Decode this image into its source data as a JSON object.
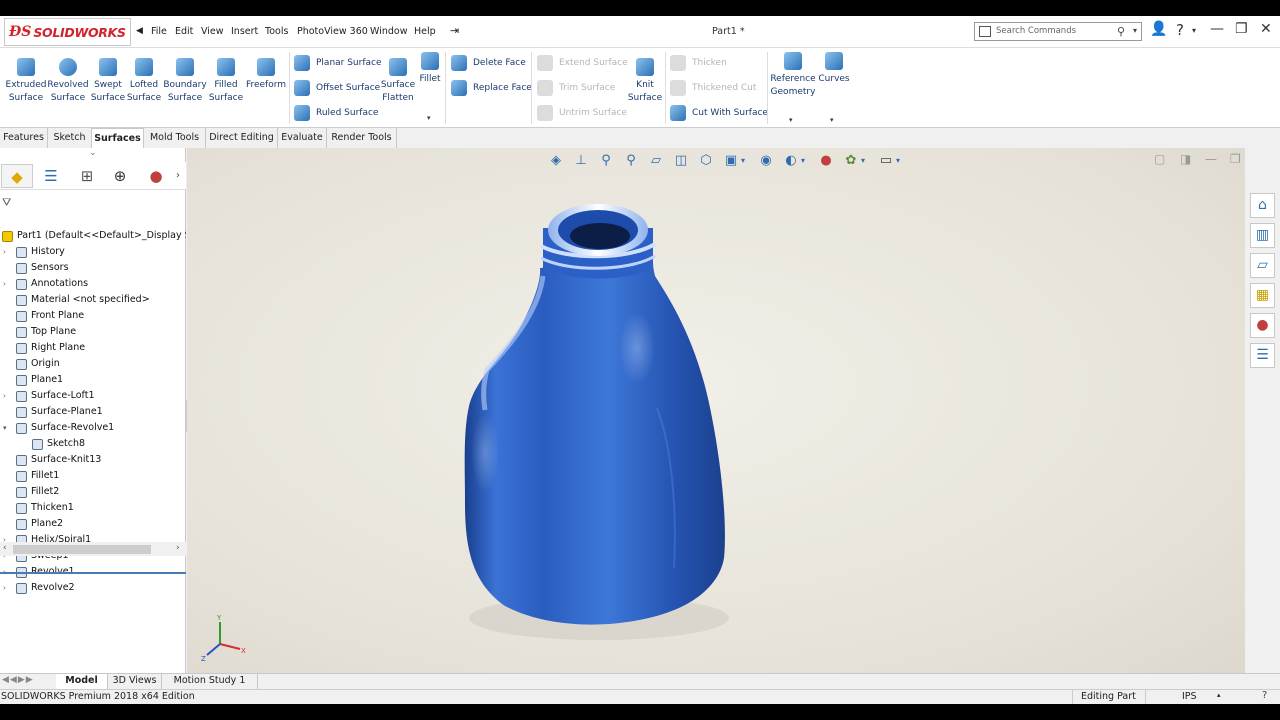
{
  "app": {
    "brand": "SOLIDWORKS",
    "doc_title": "Part1 *",
    "menu": [
      "File",
      "Edit",
      "View",
      "Insert",
      "Tools",
      "PhotoView 360",
      "Window",
      "Help"
    ],
    "search_placeholder": "Search Commands"
  },
  "ribbon": {
    "large": [
      {
        "label": "Extruded Surface"
      },
      {
        "label": "Revolved Surface"
      },
      {
        "label": "Swept Surface"
      },
      {
        "label": "Lofted Surface"
      },
      {
        "label": "Boundary Surface"
      },
      {
        "label": "Filled Surface"
      },
      {
        "label": "Freeform"
      }
    ],
    "group2": [
      "Planar Surface",
      "Offset Surface",
      "Ruled Surface"
    ],
    "surface_flatten": "Surface Flatten",
    "fillet": "Fillet",
    "group3": [
      "Delete Face",
      "Replace Face"
    ],
    "group4_disabled": [
      "Extend Surface",
      "Trim Surface",
      "Untrim Surface"
    ],
    "knit_surface": "Knit Surface",
    "group5": [
      "Thicken",
      "Thickened Cut",
      "Cut With Surface"
    ],
    "reference_geometry": "Reference Geometry",
    "curves": "Curves"
  },
  "tabs": [
    "Features",
    "Sketch",
    "Surfaces",
    "Mold Tools",
    "Direct Editing",
    "Evaluate",
    "Render Tools"
  ],
  "active_tab": "Surfaces",
  "tree": {
    "root": "Part1  (Default<<Default>_Display Sta",
    "items": [
      {
        "label": "History",
        "exp": true
      },
      {
        "label": "Sensors",
        "exp": false
      },
      {
        "label": "Annotations",
        "exp": true
      },
      {
        "label": "Material <not specified>",
        "exp": false
      },
      {
        "label": "Front Plane",
        "exp": false
      },
      {
        "label": "Top Plane",
        "exp": false
      },
      {
        "label": "Right Plane",
        "exp": false
      },
      {
        "label": "Origin",
        "exp": false
      },
      {
        "label": "Plane1",
        "exp": false
      },
      {
        "label": "Surface-Loft1",
        "exp": true
      },
      {
        "label": "Surface-Plane1",
        "exp": false
      },
      {
        "label": "Surface-Revolve1",
        "exp": true,
        "open": true
      },
      {
        "label": "Sketch8",
        "exp": false,
        "child": true
      },
      {
        "label": "Surface-Knit13",
        "exp": false
      },
      {
        "label": "Fillet1",
        "exp": false
      },
      {
        "label": "Fillet2",
        "exp": false
      },
      {
        "label": "Thicken1",
        "exp": false
      },
      {
        "label": "Plane2",
        "exp": false
      },
      {
        "label": "Helix/Spiral1",
        "exp": true
      },
      {
        "label": "Sweep1",
        "exp": true
      },
      {
        "label": "Revolve1",
        "exp": true
      },
      {
        "label": "Revolve2",
        "exp": true
      }
    ]
  },
  "bottom_tabs": [
    "Model",
    "3D Views",
    "Motion Study 1"
  ],
  "status": {
    "left": "SOLIDWORKS Premium 2018 x64 Edition",
    "mode": "Editing Part",
    "units": "IPS"
  },
  "colors": {
    "bottle": "#2f66c4",
    "brand_red": "#d2232a",
    "viewport_bg": "#e6e2d8"
  }
}
